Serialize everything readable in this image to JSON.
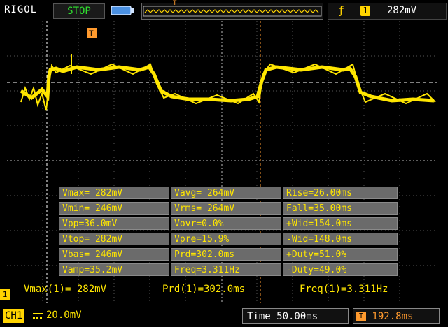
{
  "header": {
    "brand": "RIGOL",
    "run_state": "STOP",
    "run_state_color": "#2fe02f",
    "trigger": {
      "edge_icon": "rising-edge-icon",
      "channel": "1",
      "level": "282mV"
    }
  },
  "colors": {
    "trace": "#ffe600",
    "grid": "#555555",
    "marker": "#ff9a2e",
    "measure_bg": "#6b6b6b"
  },
  "measurements": [
    [
      "Vmax= 282mV",
      "Vavg= 264mV",
      "Rise=26.00ms"
    ],
    [
      "Vmin= 246mV",
      "Vrms= 264mV",
      "Fall=35.00ms"
    ],
    [
      "Vpp=36.0mV",
      "Vovr=0.0%",
      "+Wid=154.0ms"
    ],
    [
      "Vtop= 282mV",
      "Vpre=15.9%",
      "-Wid=148.0ms"
    ],
    [
      "Vbas= 246mV",
      "Prd=302.0ms",
      "+Duty=51.0%"
    ],
    [
      "Vamp=35.2mV",
      "Freq=3.311Hz",
      "-Duty=49.0%"
    ]
  ],
  "readouts": {
    "vmax": "Vmax(1)= 282mV",
    "prd": "Prd(1)=302.0ms",
    "freq": "Freq(1)=3.311Hz"
  },
  "footer": {
    "channel": "CH1",
    "coupling_icon": "dc-coupling-icon",
    "scale": "20.0mV",
    "timebase": "Time 50.00ms",
    "delay": "192.8ms",
    "delay_icon": "trigger-delay-icon"
  },
  "marker_label": "T",
  "channel_marker": "1"
}
